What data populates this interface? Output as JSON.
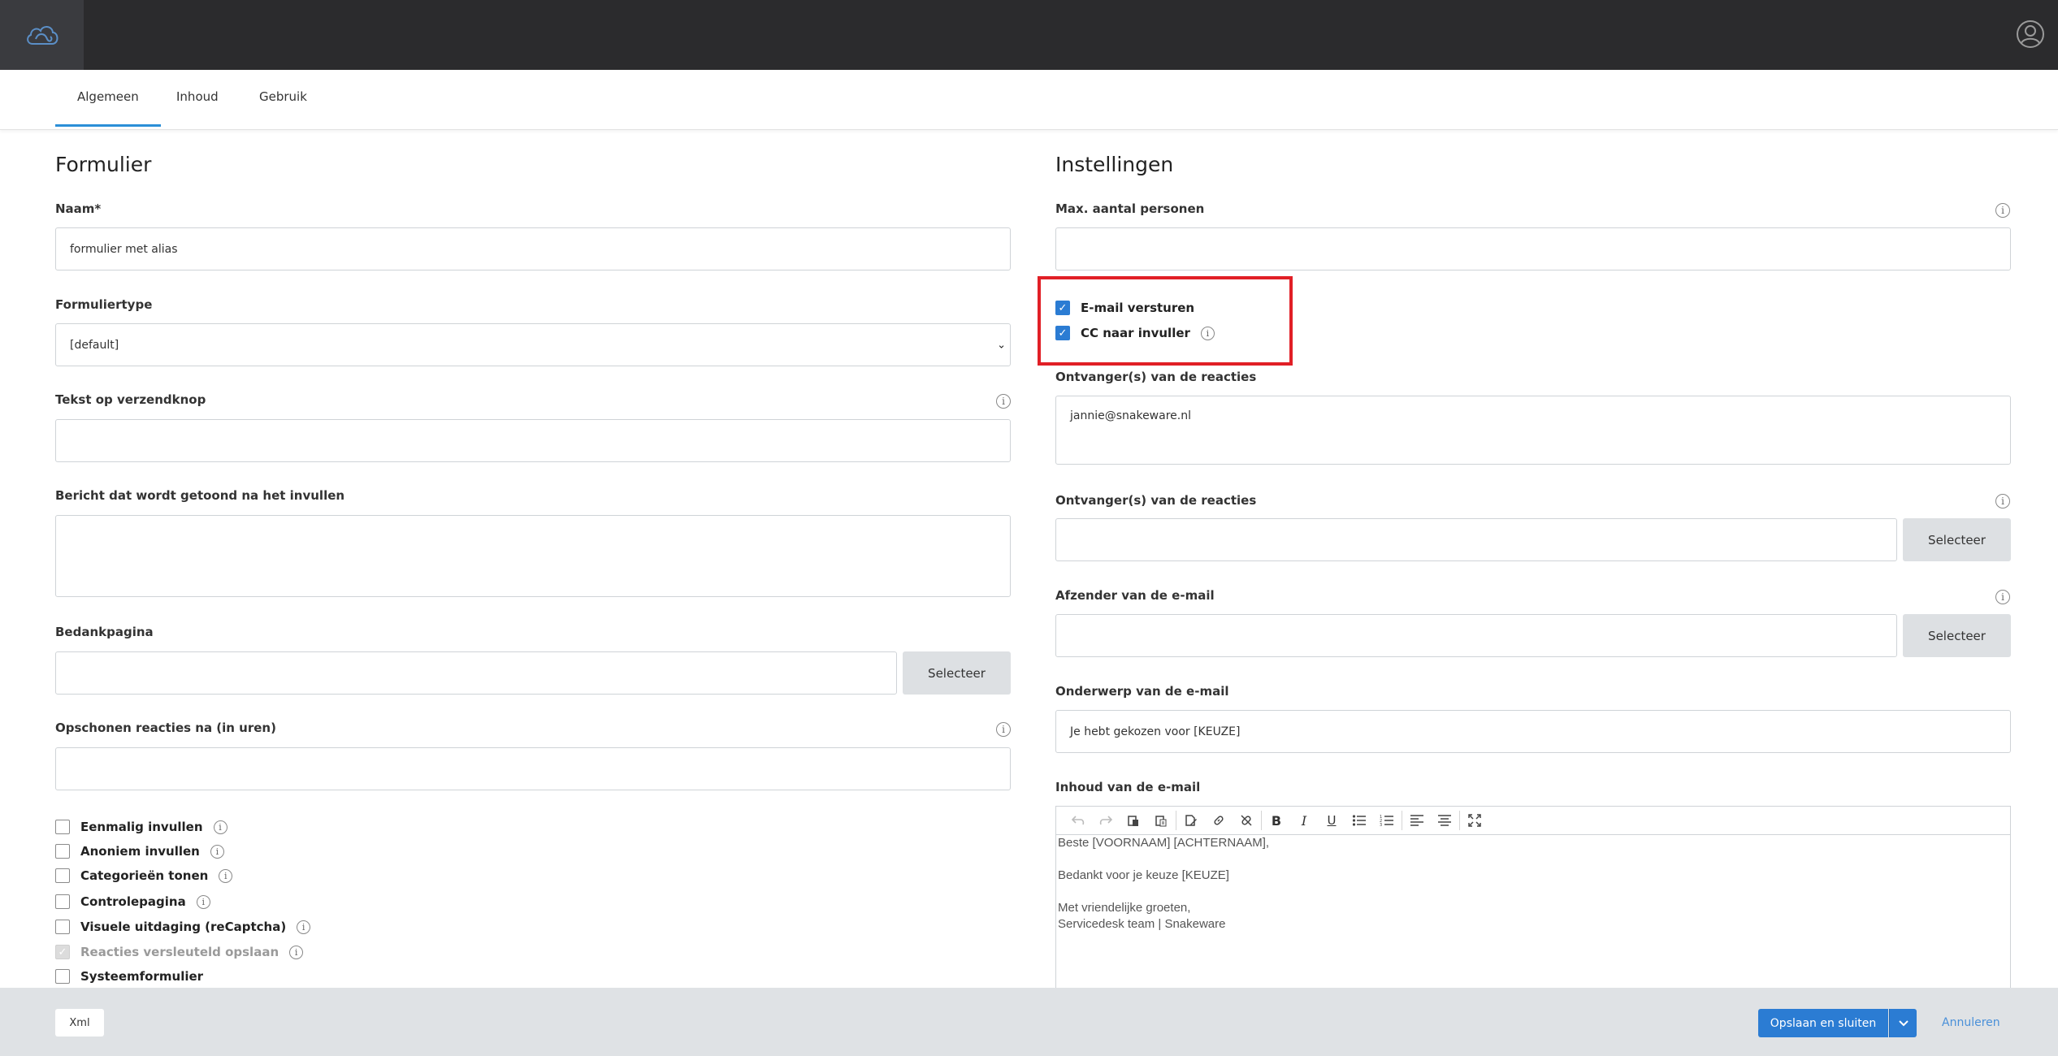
{
  "header": {
    "logo_icon": "cloud-logo-icon",
    "user_icon": "user-icon",
    "accent_color": "#2b8fd7"
  },
  "tabs": [
    {
      "label": "Algemeen",
      "active": true
    },
    {
      "label": "Inhoud",
      "active": false
    },
    {
      "label": "Gebruik",
      "active": false
    }
  ],
  "formulier": {
    "title": "Formulier",
    "naam_label": "Naam*",
    "naam_value": "formulier met alias",
    "formuliertype_label": "Formuliertype",
    "formuliertype_value": "[default]",
    "tekst_label": "Tekst op verzendknop",
    "tekst_value": "",
    "bericht_label": "Bericht dat wordt getoond na het invullen",
    "bericht_value": "",
    "bedankpagina_label": "Bedankpagina",
    "bedankpagina_value": "",
    "bedankpagina_button": "Selecteer",
    "opschonen_label": "Opschonen reacties na (in uren)",
    "opschonen_value": "",
    "checkboxes": [
      {
        "label": "Eenmalig invullen",
        "checked": false,
        "info": true
      },
      {
        "label": "Anoniem invullen",
        "checked": false,
        "info": true
      },
      {
        "label": "Categorieën tonen",
        "checked": false,
        "info": true
      },
      {
        "label": "Controlepagina",
        "checked": false,
        "info": true
      },
      {
        "label": "Visuele uitdaging (reCaptcha)",
        "checked": false,
        "info": true
      },
      {
        "label": "Reacties versleuteld opslaan",
        "checked": true,
        "disabled": true,
        "info": true
      },
      {
        "label": "Systeemformulier",
        "checked": false,
        "info": false
      }
    ]
  },
  "instellingen": {
    "title": "Instellingen",
    "max_label": "Max. aantal personen",
    "max_value": "",
    "email_versturen_label": "E-mail versturen",
    "cc_label": "CC naar invuller",
    "ontvangers1_label": "Ontvanger(s) van de reacties",
    "ontvangers1_value": "jannie@snakeware.nl",
    "ontvangers2_label": "Ontvanger(s) van de reacties",
    "ontvangers2_value": "",
    "ontvangers2_button": "Selecteer",
    "afzender_label": "Afzender van de e-mail",
    "afzender_value": "",
    "afzender_button": "Selecteer",
    "onderwerp_label": "Onderwerp van de e-mail",
    "onderwerp_value": "Je hebt gekozen voor [KEUZE]",
    "inhoud_label": "Inhoud van de e-mail",
    "editor_toolbar_icons": [
      "undo-icon",
      "redo-icon",
      "paste-icon",
      "paste-text-icon",
      "paste-word-icon",
      "link-icon",
      "unlink-icon",
      "bold-icon",
      "italic-icon",
      "underline-icon",
      "bullet-list-icon",
      "numbered-list-icon",
      "align-left-icon",
      "align-center-icon",
      "fullscreen-icon"
    ],
    "editor_lines": [
      "Beste [VOORNAAM] [ACHTERNAAM],",
      "",
      "Bedankt voor je keuze [KEUZE]",
      "",
      "Met vriendelijke groeten,",
      "Servicedesk team | Snakeware"
    ]
  },
  "footer": {
    "xml_label": "Xml",
    "save_label": "Opslaan en sluiten",
    "cancel_label": "Annuleren",
    "primary_color": "#2b7cd3"
  }
}
